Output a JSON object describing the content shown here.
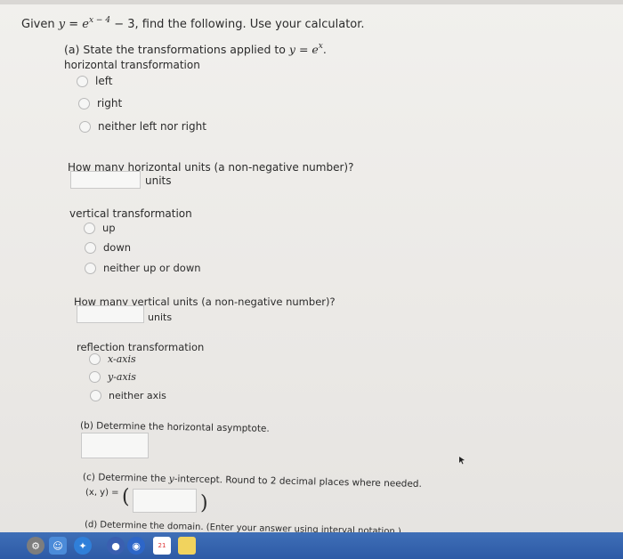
{
  "question": {
    "given_prefix": "Given ",
    "y_var": "y",
    "equals": " = ",
    "e_base": "e",
    "exponent": "x − 4",
    "given_suffix": " − 3, find the following. Use your calculator."
  },
  "part_a": {
    "heading_prefix": "(a) State the transformations applied to ",
    "heading_y": "y",
    "heading_eq": " = ",
    "heading_e": "e",
    "heading_exp": "x",
    "heading_end": ".",
    "horizontal": {
      "label": "horizontal transformation",
      "options": [
        "left",
        "right",
        "neither left nor right"
      ],
      "units_question": "How many horizontal units (a non-negative number)?",
      "units_label": "units",
      "units_value": ""
    },
    "vertical": {
      "label": "vertical transformation",
      "options": [
        "up",
        "down",
        "neither up or down"
      ],
      "units_question": "How many vertical units (a non-negative number)?",
      "units_label": "units",
      "units_value": ""
    },
    "reflection": {
      "label": "reflection transformation",
      "options": [
        "x-axis",
        "y-axis",
        "neither axis"
      ]
    }
  },
  "part_b": {
    "label": "(b) Determine the horizontal asymptote.",
    "value": ""
  },
  "part_c": {
    "label_prefix": "(c) Determine the ",
    "label_var": "y",
    "label_suffix": "-intercept. Round to 2 decimal places where needed.",
    "coord_label": "(x, y) = ",
    "open_paren": "(",
    "close_paren": ")",
    "value": ""
  },
  "part_d": {
    "label": "(d) Determine the domain. (Enter your answer using interval notation.)"
  },
  "taskbar": {
    "icons": [
      "settings-icon",
      "finder-icon",
      "safari-icon",
      "app-icon",
      "calendar-icon",
      "notes-icon"
    ],
    "calendar_badge": "21"
  }
}
